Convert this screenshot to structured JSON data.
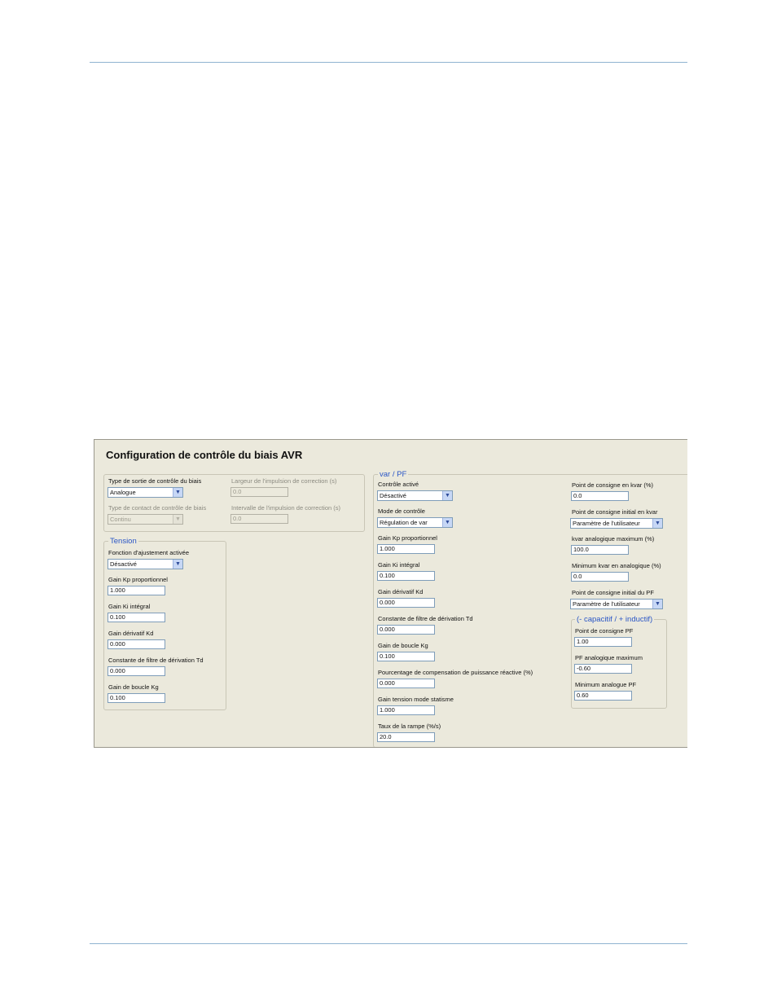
{
  "panel": {
    "title": "Configuration de contrôle du biais AVR"
  },
  "bias": {
    "output_type_label": "Type de sortie de contrôle du biais",
    "output_type_value": "Analogue",
    "contact_type_label": "Type de contact de contrôle de biais",
    "contact_type_value": "Continu",
    "pulse_width_label": "Largeur de l'impulsion de correction (s)",
    "pulse_width_value": "0.0",
    "pulse_interval_label": "Intervalle de l'impulsion de correction (s)",
    "pulse_interval_value": "0.0"
  },
  "tension": {
    "legend": "Tension",
    "fields": [
      {
        "label": "Fonction d'ajustement activée",
        "value": "Désactivé"
      },
      {
        "label": "Gain Kp proportionnel",
        "value": "1.000"
      },
      {
        "label": "Gain Ki intégral",
        "value": "0.100"
      },
      {
        "label": "Gain dérivatif Kd",
        "value": "0.000"
      },
      {
        "label": "Constante de filtre de dérivation Td",
        "value": "0.000"
      },
      {
        "label": "Gain de boucle Kg",
        "value": "0.100"
      }
    ]
  },
  "varpf": {
    "legend": "var / PF",
    "fields": [
      {
        "label": "Contrôle activé",
        "value": "Désactivé"
      },
      {
        "label": "Mode de contrôle",
        "value": "Régulation de var"
      },
      {
        "label": "Gain Kp proportionnel",
        "value": "1.000"
      },
      {
        "label": "Gain Ki intégral",
        "value": "0.100"
      },
      {
        "label": "Gain dérivatif Kd",
        "value": "0.000"
      },
      {
        "label": "Constante de filtre de dérivation Td",
        "value": "0.000"
      },
      {
        "label": "Gain de boucle Kg",
        "value": "0.100"
      },
      {
        "label": "Pourcentage de compensation de puissance réactive (%)",
        "value": "0.000"
      },
      {
        "label": "Gain tension mode statisme",
        "value": "1.000"
      },
      {
        "label": "Taux de la rampe (%/s)",
        "value": "20.0"
      }
    ]
  },
  "right": {
    "fields": [
      {
        "label": "Point de consigne en kvar (%)",
        "value": "0.0"
      },
      {
        "label": "Point de consigne initial en kvar",
        "value": "Paramètre de l'utilisateur"
      },
      {
        "label": "kvar analogique maximum (%)",
        "value": "100.0"
      },
      {
        "label": "Minimum kvar en analogique (%)",
        "value": "0.0"
      },
      {
        "label": "Point de consigne initial du PF",
        "value": "Paramètre de l'utilisateur"
      }
    ]
  },
  "pf": {
    "legend": "(- capacitif / + inductif)",
    "fields": [
      {
        "label": "Point de consigne PF",
        "value": "1.00"
      },
      {
        "label": "PF analogique maximum",
        "value": "-0.60"
      },
      {
        "label": "Minimum analogue PF",
        "value": "0.60"
      }
    ]
  }
}
